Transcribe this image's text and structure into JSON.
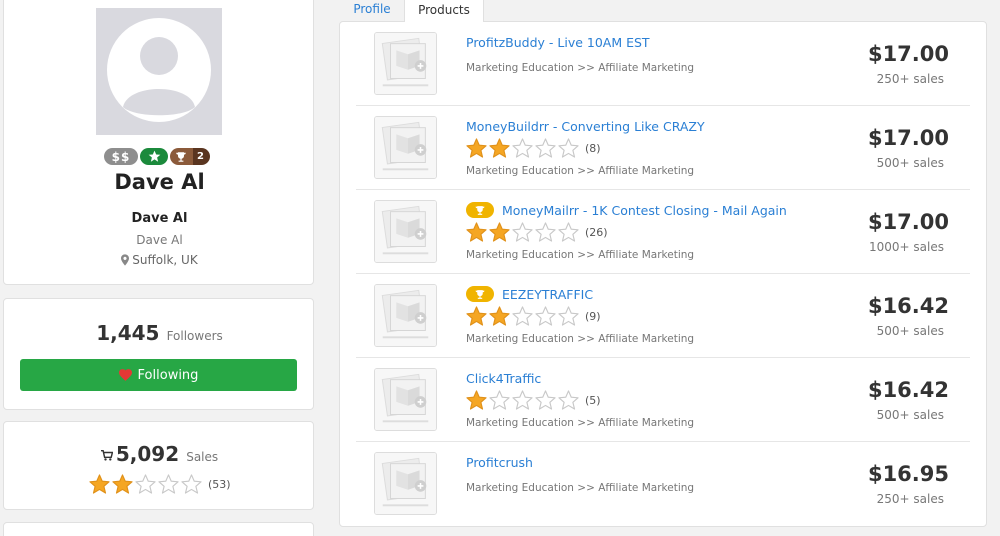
{
  "tabs": [
    {
      "label": "Profile",
      "active": false
    },
    {
      "label": "Products",
      "active": true
    }
  ],
  "profile": {
    "display_name": "Dave Al",
    "name": "Dave Al",
    "username": "Dave Al",
    "location": "Suffolk, UK",
    "badges": {
      "dollar": "$$",
      "trophy_count": "2"
    },
    "icons": [
      "avatar-placeholder",
      "dollar-badge",
      "star-badge",
      "trophy-badge",
      "map-pin-icon"
    ]
  },
  "followers": {
    "count": "1,445",
    "label": "Followers",
    "button_label": "Following",
    "button_color": "#27a745"
  },
  "sales": {
    "count": "5,092",
    "label": "Sales",
    "rating_stars": 2,
    "rating_count": "(53)"
  },
  "products": [
    {
      "title": "ProfitzBuddy - Live 10AM EST",
      "has_trophy": false,
      "rating_stars": null,
      "rating_count": null,
      "category": "Marketing Education >> Affiliate Marketing",
      "price": "$17.00",
      "sales": "250+ sales"
    },
    {
      "title": "MoneyBuildrr - Converting Like CRAZY",
      "has_trophy": false,
      "rating_stars": 2,
      "rating_count": "(8)",
      "category": "Marketing Education >> Affiliate Marketing",
      "price": "$17.00",
      "sales": "500+ sales"
    },
    {
      "title": "MoneyMailrr - 1K Contest Closing - Mail Again",
      "has_trophy": true,
      "rating_stars": 2,
      "rating_count": "(26)",
      "category": "Marketing Education >> Affiliate Marketing",
      "price": "$17.00",
      "sales": "1000+ sales"
    },
    {
      "title": "EEZEYTRAFFIC",
      "has_trophy": true,
      "rating_stars": 2,
      "rating_count": "(9)",
      "category": "Marketing Education >> Affiliate Marketing",
      "price": "$16.42",
      "sales": "500+ sales"
    },
    {
      "title": "Click4Traffic",
      "has_trophy": false,
      "rating_stars": 1,
      "rating_count": "(5)",
      "category": "Marketing Education >> Affiliate Marketing",
      "price": "$16.42",
      "sales": "500+ sales"
    },
    {
      "title": "Profitcrush",
      "has_trophy": false,
      "rating_stars": null,
      "rating_count": null,
      "category": "Marketing Education >> Affiliate Marketing",
      "price": "$16.95",
      "sales": "250+ sales"
    }
  ],
  "colors": {
    "link": "#2a7fd4",
    "star_filled": "#f5a623",
    "trophy_badge": "#f0b400"
  }
}
